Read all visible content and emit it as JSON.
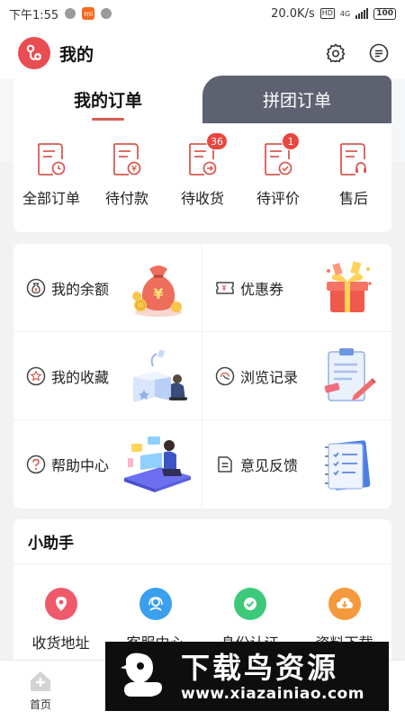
{
  "status_bar": {
    "time": "下午1:55",
    "speed": "20.0K/s",
    "hd": "HD",
    "network": "4G",
    "battery": "100",
    "mi_label": "mi"
  },
  "header": {
    "title": "我的",
    "settings_icon": "gear-icon",
    "message_icon": "message-icon"
  },
  "orders": {
    "tabs": [
      {
        "label": "我的订单",
        "active": true
      },
      {
        "label": "拼团订单",
        "active": false
      }
    ],
    "items": [
      {
        "label": "全部订单",
        "icon": "order-clock-icon",
        "badge": ""
      },
      {
        "label": "待付款",
        "icon": "order-yen-icon",
        "badge": ""
      },
      {
        "label": "待收货",
        "icon": "order-arrow-icon",
        "badge": "36"
      },
      {
        "label": "待评价",
        "icon": "order-check-icon",
        "badge": "1"
      },
      {
        "label": "售后",
        "icon": "order-headset-icon",
        "badge": ""
      }
    ]
  },
  "services": [
    {
      "label": "我的余额",
      "icon": "money-bag-icon",
      "illustration": "money-bag-illustration"
    },
    {
      "label": "优惠券",
      "icon": "coupon-icon",
      "illustration": "gift-box-illustration"
    },
    {
      "label": "我的收藏",
      "icon": "star-icon",
      "illustration": "favorites-box-illustration"
    },
    {
      "label": "浏览记录",
      "icon": "history-icon",
      "illustration": "clipboard-illustration"
    },
    {
      "label": "帮助中心",
      "icon": "question-icon",
      "illustration": "help-desk-illustration"
    },
    {
      "label": "意见反馈",
      "icon": "feedback-icon",
      "illustration": "notebook-illustration"
    }
  ],
  "helper": {
    "title": "小助手",
    "items": [
      {
        "label": "收货地址",
        "icon": "location-icon",
        "color": "#ef5a6a"
      },
      {
        "label": "客服中心",
        "icon": "customer-service-icon",
        "color": "#3aa0ee"
      },
      {
        "label": "身份认证",
        "icon": "verified-icon",
        "color": "#3dc97a"
      },
      {
        "label": "资料下载",
        "icon": "cloud-download-icon",
        "color": "#f59a3c"
      }
    ]
  },
  "bottom_nav": {
    "items": [
      {
        "label": "首页",
        "icon": "home-icon"
      }
    ]
  },
  "watermark": {
    "main": "下载鸟资源",
    "url": "www.xiazainiao.com"
  },
  "colors": {
    "accent": "#d95a50",
    "badge": "#e8473f",
    "tab_inactive": "#5e6170"
  }
}
